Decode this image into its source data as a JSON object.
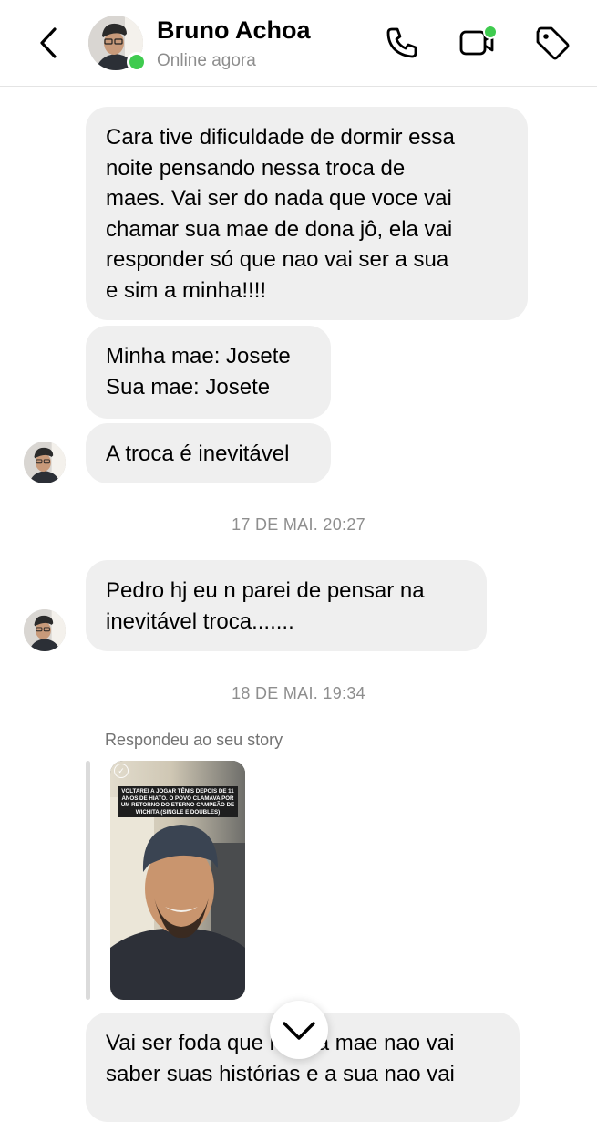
{
  "header": {
    "name": "Bruno Achoa",
    "status": "Online agora",
    "icons": {
      "back": "chevron-left-icon",
      "call": "phone-icon",
      "video": "video-camera-icon",
      "tag": "tag-icon"
    },
    "online_color": "#3fcb4f"
  },
  "messages": [
    {
      "text": "Cara tive dificuldade de dormir essa\nnoite pensando nessa troca de\nmaes.  Vai ser do nada que voce vai\nchamar sua mae de dona jô, ela vai\nresponder só que nao vai ser a sua\ne sim a minha!!!!"
    },
    {
      "text": "Minha mae: Josete\nSua mae: Josete"
    },
    {
      "text": "A troca é inevitável"
    },
    {
      "text": "Pedro hj eu n parei de pensar na\ninevitável troca......."
    },
    {
      "text": "Vai ser foda que minha mae nao vai\nsaber suas histórias e a sua nao vai"
    }
  ],
  "timestamps": [
    "17 DE MAI. 20:27",
    "18 DE MAI. 19:34"
  ],
  "reply": {
    "label": "Respondeu ao seu story",
    "story_caption": "VOLTAREI A JOGAR TÊNIS DEPOIS DE 11 ANOS DE HIATO. O POVO CLAMAVA POR UM RETORNO DO ETERNO CAMPEÃO DE WICHITA (SINGLE E DOUBLES)"
  },
  "colors": {
    "bubble": "#efefef",
    "muted_text": "#8e8e8e"
  },
  "scroll_button_icon": "chevron-down-icon"
}
